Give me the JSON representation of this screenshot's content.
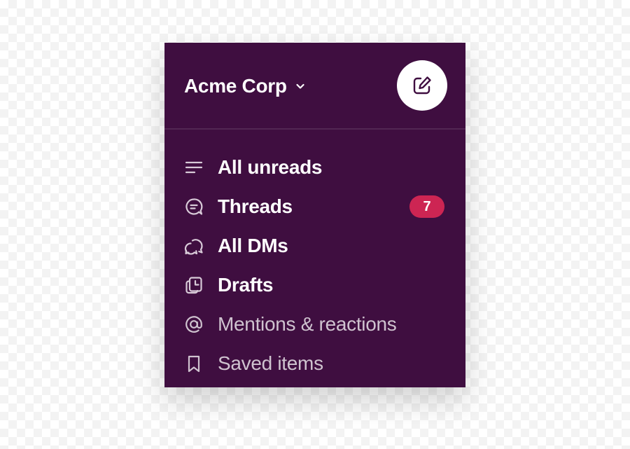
{
  "workspace": {
    "name": "Acme Corp",
    "chevron_icon": "chevron-down-icon",
    "compose_icon": "compose-icon"
  },
  "nav": {
    "items": [
      {
        "label": "All unreads",
        "icon": "all-unreads-icon",
        "weight": "bold"
      },
      {
        "label": "Threads",
        "icon": "threads-icon",
        "weight": "bold",
        "badge": "7"
      },
      {
        "label": "All DMs",
        "icon": "dms-icon",
        "weight": "bold"
      },
      {
        "label": "Drafts",
        "icon": "drafts-icon",
        "weight": "bold"
      },
      {
        "label": "Mentions & reactions",
        "icon": "mention-icon",
        "weight": "normal"
      },
      {
        "label": "Saved items",
        "icon": "bookmark-icon",
        "weight": "normal"
      }
    ]
  },
  "colors": {
    "sidebar_bg": "#3f0e40",
    "divider": "#522653",
    "badge_bg": "#cd2553",
    "dim_text": "#cfc3cf"
  }
}
